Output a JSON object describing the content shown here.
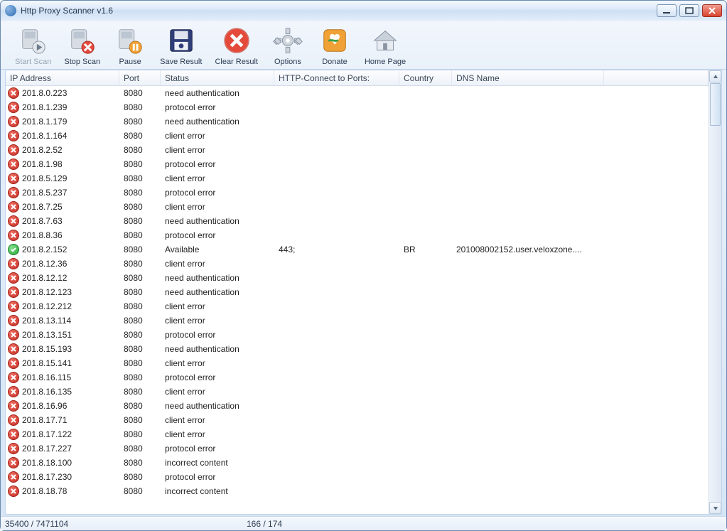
{
  "window": {
    "title": "Http Proxy Scanner v1.6"
  },
  "toolbar": {
    "start": "Start Scan",
    "stop": "Stop Scan",
    "pause": "Pause",
    "save": "Save Result",
    "clear": "Clear Result",
    "options": "Options",
    "donate": "Donate",
    "home": "Home Page"
  },
  "columns": {
    "ip": "IP Address",
    "port": "Port",
    "status": "Status",
    "http": "HTTP-Connect to Ports:",
    "country": "Country",
    "dns": "DNS Name"
  },
  "rows": [
    {
      "ok": false,
      "ip": "201.8.0.223",
      "port": "8080",
      "status": "need authentication",
      "http": "",
      "country": "",
      "dns": ""
    },
    {
      "ok": false,
      "ip": "201.8.1.239",
      "port": "8080",
      "status": "protocol error",
      "http": "",
      "country": "",
      "dns": ""
    },
    {
      "ok": false,
      "ip": "201.8.1.179",
      "port": "8080",
      "status": "need authentication",
      "http": "",
      "country": "",
      "dns": ""
    },
    {
      "ok": false,
      "ip": "201.8.1.164",
      "port": "8080",
      "status": "client error",
      "http": "",
      "country": "",
      "dns": ""
    },
    {
      "ok": false,
      "ip": "201.8.2.52",
      "port": "8080",
      "status": "client error",
      "http": "",
      "country": "",
      "dns": ""
    },
    {
      "ok": false,
      "ip": "201.8.1.98",
      "port": "8080",
      "status": "protocol error",
      "http": "",
      "country": "",
      "dns": ""
    },
    {
      "ok": false,
      "ip": "201.8.5.129",
      "port": "8080",
      "status": "client error",
      "http": "",
      "country": "",
      "dns": ""
    },
    {
      "ok": false,
      "ip": "201.8.5.237",
      "port": "8080",
      "status": "protocol error",
      "http": "",
      "country": "",
      "dns": ""
    },
    {
      "ok": false,
      "ip": "201.8.7.25",
      "port": "8080",
      "status": "client error",
      "http": "",
      "country": "",
      "dns": ""
    },
    {
      "ok": false,
      "ip": "201.8.7.63",
      "port": "8080",
      "status": "need authentication",
      "http": "",
      "country": "",
      "dns": ""
    },
    {
      "ok": false,
      "ip": "201.8.8.36",
      "port": "8080",
      "status": "protocol error",
      "http": "",
      "country": "",
      "dns": ""
    },
    {
      "ok": true,
      "ip": "201.8.2.152",
      "port": "8080",
      "status": "Available",
      "http": "443;",
      "country": "BR",
      "dns": "201008002152.user.veloxzone...."
    },
    {
      "ok": false,
      "ip": "201.8.12.36",
      "port": "8080",
      "status": "client error",
      "http": "",
      "country": "",
      "dns": ""
    },
    {
      "ok": false,
      "ip": "201.8.12.12",
      "port": "8080",
      "status": "need authentication",
      "http": "",
      "country": "",
      "dns": ""
    },
    {
      "ok": false,
      "ip": "201.8.12.123",
      "port": "8080",
      "status": "need authentication",
      "http": "",
      "country": "",
      "dns": ""
    },
    {
      "ok": false,
      "ip": "201.8.12.212",
      "port": "8080",
      "status": "client error",
      "http": "",
      "country": "",
      "dns": ""
    },
    {
      "ok": false,
      "ip": "201.8.13.114",
      "port": "8080",
      "status": "client error",
      "http": "",
      "country": "",
      "dns": ""
    },
    {
      "ok": false,
      "ip": "201.8.13.151",
      "port": "8080",
      "status": "protocol error",
      "http": "",
      "country": "",
      "dns": ""
    },
    {
      "ok": false,
      "ip": "201.8.15.193",
      "port": "8080",
      "status": "need authentication",
      "http": "",
      "country": "",
      "dns": ""
    },
    {
      "ok": false,
      "ip": "201.8.15.141",
      "port": "8080",
      "status": "client error",
      "http": "",
      "country": "",
      "dns": ""
    },
    {
      "ok": false,
      "ip": "201.8.16.115",
      "port": "8080",
      "status": "protocol error",
      "http": "",
      "country": "",
      "dns": ""
    },
    {
      "ok": false,
      "ip": "201.8.16.135",
      "port": "8080",
      "status": "client error",
      "http": "",
      "country": "",
      "dns": ""
    },
    {
      "ok": false,
      "ip": "201.8.16.96",
      "port": "8080",
      "status": "need authentication",
      "http": "",
      "country": "",
      "dns": ""
    },
    {
      "ok": false,
      "ip": "201.8.17.71",
      "port": "8080",
      "status": "client error",
      "http": "",
      "country": "",
      "dns": ""
    },
    {
      "ok": false,
      "ip": "201.8.17.122",
      "port": "8080",
      "status": "client error",
      "http": "",
      "country": "",
      "dns": ""
    },
    {
      "ok": false,
      "ip": "201.8.17.227",
      "port": "8080",
      "status": "protocol error",
      "http": "",
      "country": "",
      "dns": ""
    },
    {
      "ok": false,
      "ip": "201.8.18.100",
      "port": "8080",
      "status": "incorrect content",
      "http": "",
      "country": "",
      "dns": ""
    },
    {
      "ok": false,
      "ip": "201.8.17.230",
      "port": "8080",
      "status": "protocol error",
      "http": "",
      "country": "",
      "dns": ""
    },
    {
      "ok": false,
      "ip": "201.8.18.78",
      "port": "8080",
      "status": "incorrect content",
      "http": "",
      "country": "",
      "dns": ""
    }
  ],
  "statusbar": {
    "progress": "35400 / 7471104",
    "counts": "166 / 174"
  }
}
